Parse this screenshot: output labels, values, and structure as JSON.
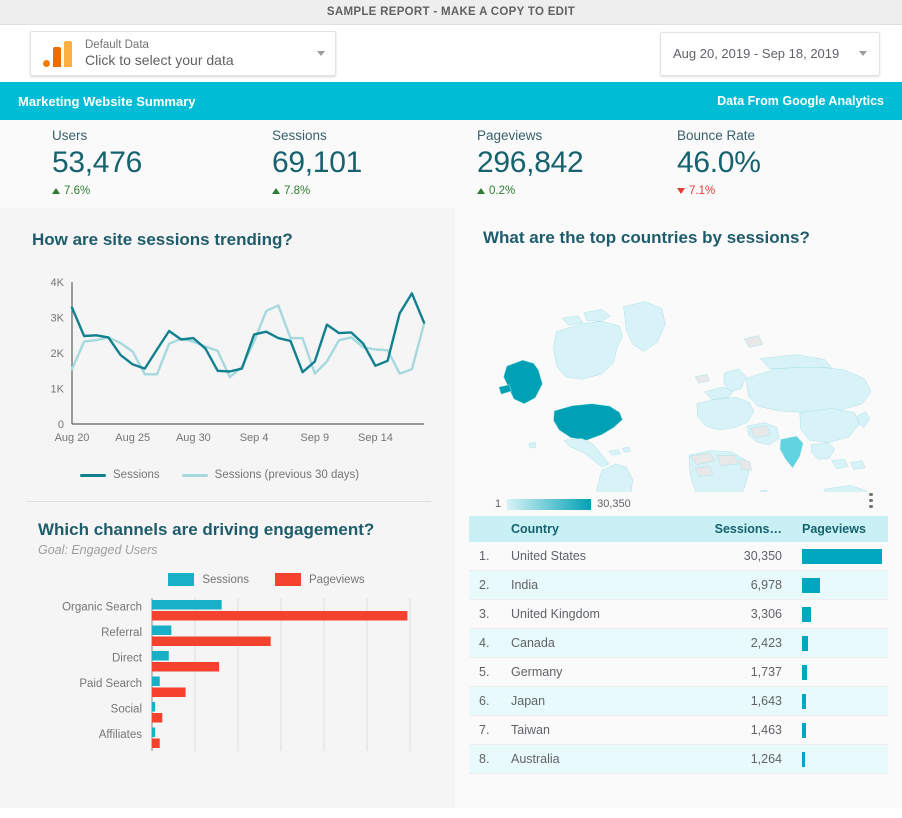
{
  "top_bar": {
    "title": "SAMPLE REPORT - MAKE A COPY TO EDIT"
  },
  "toolbar": {
    "data_source": {
      "icon": "google-analytics-icon",
      "label": "Default Data",
      "value": "Click to select your data"
    },
    "date_range": {
      "value": "Aug 20, 2019 - Sep 18, 2019"
    }
  },
  "banner": {
    "left": "Marketing Website Summary",
    "right": "Data From Google Analytics",
    "color": "#00bcd4"
  },
  "scorecards": [
    {
      "title": "Users",
      "value": "53,476",
      "delta": "7.6%",
      "direction": "up"
    },
    {
      "title": "Sessions",
      "value": "69,101",
      "delta": "7.8%",
      "direction": "up"
    },
    {
      "title": "Pageviews",
      "value": "296,842",
      "delta": "0.2%",
      "direction": "up"
    },
    {
      "title": "Bounce Rate",
      "value": "46.0%",
      "delta": "7.1%",
      "direction": "down"
    }
  ],
  "line_panel": {
    "title": "How are site sessions trending?"
  },
  "bar_panel": {
    "title": "Which channels are driving engagement?",
    "subtitle": "Goal: Engaged Users"
  },
  "map_panel": {
    "title": "What are the top countries by sessions?",
    "legend_min": "1",
    "legend_max": "30,350",
    "menu_icon": "kebab-menu-icon"
  },
  "table": {
    "columns": [
      "Country",
      "Sessions…",
      "Pageviews"
    ],
    "rows": [
      {
        "rank": "1.",
        "country": "United States",
        "sessions": "30,350",
        "pv": 30350
      },
      {
        "rank": "2.",
        "country": "India",
        "sessions": "6,978",
        "pv": 6978
      },
      {
        "rank": "3.",
        "country": "United Kingdom",
        "sessions": "3,306",
        "pv": 3306
      },
      {
        "rank": "4.",
        "country": "Canada",
        "sessions": "2,423",
        "pv": 2423
      },
      {
        "rank": "5.",
        "country": "Germany",
        "sessions": "1,737",
        "pv": 1737
      },
      {
        "rank": "6.",
        "country": "Japan",
        "sessions": "1,643",
        "pv": 1643
      },
      {
        "rank": "7.",
        "country": "Taiwan",
        "sessions": "1,463",
        "pv": 1463
      },
      {
        "rank": "8.",
        "country": "Australia",
        "sessions": "1,264",
        "pv": 1264
      }
    ]
  },
  "chart_data": [
    {
      "type": "line",
      "title": "How are site sessions trending?",
      "xlabel": "",
      "ylabel": "",
      "ylim": [
        0,
        4000
      ],
      "yticks": [
        "0",
        "1K",
        "2K",
        "3K",
        "4K"
      ],
      "xticks": [
        "Aug 20",
        "Aug 25",
        "Aug 30",
        "Sep 4",
        "Sep 9",
        "Sep 14"
      ],
      "grid": false,
      "legend_position": "bottom",
      "colors": {
        "current": "#12808f",
        "previous": "#a6d9de"
      },
      "x": [
        "Aug 20",
        "Aug 21",
        "Aug 22",
        "Aug 23",
        "Aug 24",
        "Aug 25",
        "Aug 26",
        "Aug 27",
        "Aug 28",
        "Aug 29",
        "Aug 30",
        "Aug 31",
        "Sep 1",
        "Sep 2",
        "Sep 3",
        "Sep 4",
        "Sep 5",
        "Sep 6",
        "Sep 7",
        "Sep 8",
        "Sep 9",
        "Sep 10",
        "Sep 11",
        "Sep 12",
        "Sep 13",
        "Sep 14",
        "Sep 15",
        "Sep 16",
        "Sep 17",
        "Sep 18"
      ],
      "series": [
        {
          "name": "Sessions",
          "values": [
            3280,
            2480,
            2500,
            2440,
            1940,
            1680,
            1560,
            2100,
            2620,
            2380,
            2420,
            2120,
            1500,
            1480,
            1560,
            2520,
            2600,
            2420,
            2340,
            1460,
            1760,
            2800,
            2560,
            2580,
            2260,
            1640,
            1780,
            3120,
            3680,
            2860
          ]
        },
        {
          "name": "Sessions (previous 30 days)",
          "values": [
            1540,
            2320,
            2360,
            2440,
            2280,
            2040,
            1400,
            1400,
            2260,
            2400,
            2320,
            2180,
            2060,
            1320,
            1600,
            2320,
            3180,
            3340,
            2420,
            2420,
            1420,
            1760,
            2360,
            2440,
            2160,
            2100,
            2080,
            1420,
            1540,
            2820
          ]
        }
      ]
    },
    {
      "type": "bar",
      "orientation": "horizontal",
      "title": "Which channels are driving engagement?",
      "subtitle": "Goal: Engaged Users",
      "categories": [
        "Organic Search",
        "Referral",
        "Direct",
        "Paid Search",
        "Social",
        "Affiliates"
      ],
      "grid": true,
      "legend_position": "top",
      "colors": {
        "Sessions": "#17b0c7",
        "Pageviews": "#f4422f"
      },
      "series": [
        {
          "name": "Sessions",
          "values": [
            27,
            7.5,
            6.5,
            3,
            1.2,
            1.2
          ]
        },
        {
          "name": "Pageviews",
          "values": [
            99,
            46,
            26,
            13,
            4,
            3
          ]
        }
      ],
      "xlim": [
        0,
        100
      ]
    },
    {
      "type": "heatmap",
      "subtype": "choropleth",
      "title": "What are the top countries by sessions?",
      "legend_min": 1,
      "legend_max": 30350,
      "colors": {
        "low": "#d8f3f7",
        "high": "#00a1b5",
        "nodata": "#e8e8e8"
      },
      "highlighted": [
        {
          "region": "United States",
          "value": 30350
        },
        {
          "region": "India",
          "value": 6978
        }
      ]
    }
  ]
}
